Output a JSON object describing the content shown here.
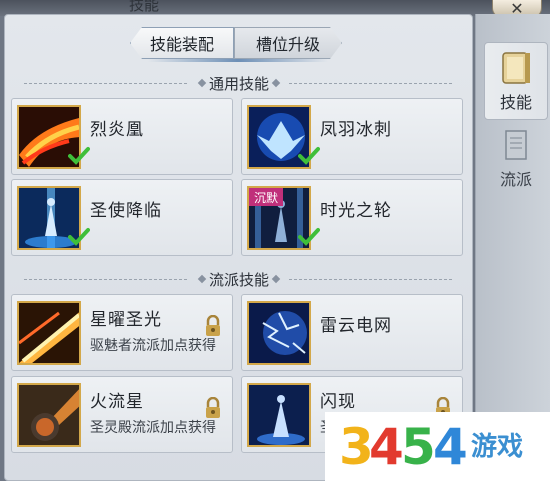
{
  "window": {
    "title": "技能",
    "close_label": "✕"
  },
  "tabs": [
    {
      "label": "技能装配",
      "active": true
    },
    {
      "label": "槽位升级",
      "active": false
    }
  ],
  "rail": [
    {
      "label": "技能",
      "icon": "skill-book-icon",
      "active": true
    },
    {
      "label": "流派",
      "icon": "faction-scroll-icon",
      "active": false
    }
  ],
  "sections": {
    "general": "通用技能",
    "faction": "流派技能"
  },
  "general_skills": [
    {
      "name": "烈炎凰",
      "equipped": true,
      "icon": "fire-phoenix-icon"
    },
    {
      "name": "凤羽冰刺",
      "equipped": true,
      "icon": "ice-phoenix-icon"
    },
    {
      "name": "圣使降临",
      "equipped": true,
      "icon": "holy-descent-icon"
    },
    {
      "name": "时光之轮",
      "equipped": true,
      "icon": "time-wheel-icon",
      "tag": "沉默"
    }
  ],
  "faction_skills": [
    {
      "name": "星曜圣光",
      "requirement": "驱魅者流派加点获得",
      "locked": true,
      "icon": "star-light-icon"
    },
    {
      "name": "雷云电网",
      "requirement": "",
      "locked": false,
      "icon": "thunder-net-icon"
    },
    {
      "name": "火流星",
      "requirement": "圣灵殿流派加点获得",
      "locked": true,
      "icon": "fire-meteor-icon"
    },
    {
      "name": "闪现",
      "requirement": "圣",
      "locked": true,
      "icon": "blink-icon"
    }
  ],
  "watermark": {
    "digits": "3454",
    "text": "游戏"
  },
  "colors": {
    "check_green": "#3fbf3a",
    "lock_gold": "#c9a24a",
    "silence_tag": "#c0307a",
    "icon_border": "#d3a84a"
  }
}
